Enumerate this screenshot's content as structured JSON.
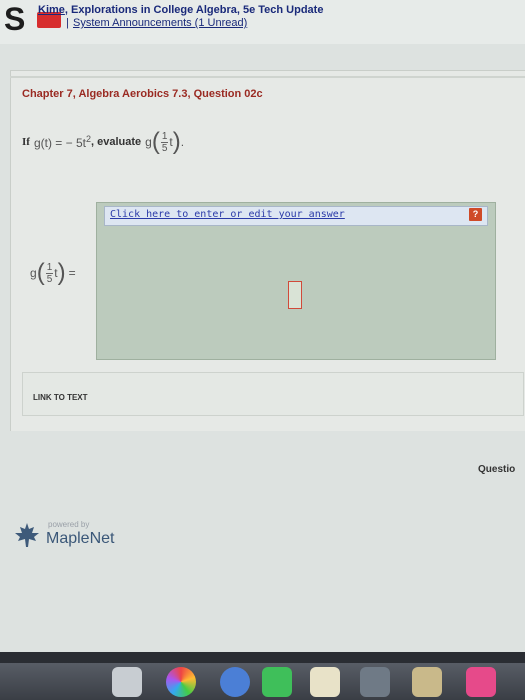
{
  "header": {
    "logo_letter": "S",
    "course_title_prefix": "Kime",
    "course_title_rest": ", Explorations in College Algebra, 5e Tech Update",
    "separator": "|",
    "announcements_link": "System Announcements (1 Unread)"
  },
  "question": {
    "title": "Chapter 7, Algebra Aerobics 7.3, Question 02c",
    "if_label": "If",
    "function_def_lhs": "g(t) = − 5t",
    "function_exponent": "2",
    "evaluate_label": ", evaluate",
    "g": "g",
    "frac_num": "1",
    "frac_den": "5",
    "var": "t",
    "period": ".",
    "equals": "="
  },
  "answer": {
    "edit_link": "Click here to enter or edit your answer",
    "help_icon_glyph": "?"
  },
  "footer": {
    "link_to_text": "LINK TO TEXT",
    "question_nav": "Questio",
    "powered_by": "powered by",
    "maplenet": "MapleNet"
  },
  "colors": {
    "title_red": "#9a2a22",
    "link_blue": "#2a3aa8",
    "answer_area": "#bccbbd",
    "help_orange": "#cf4a28"
  }
}
